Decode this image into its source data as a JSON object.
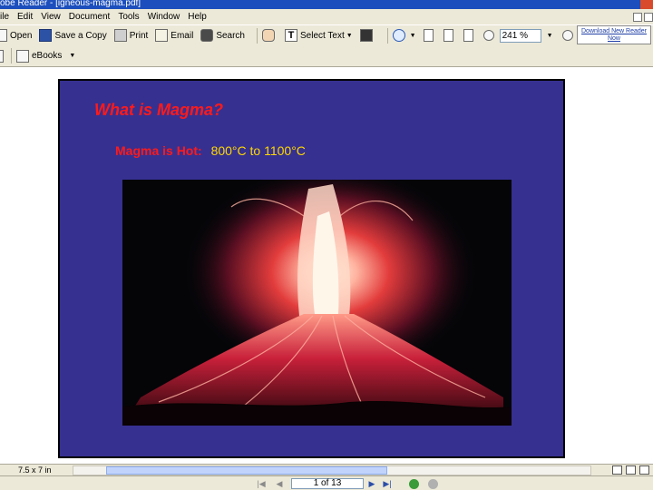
{
  "window": {
    "title": "obe Reader - [igneous-magma.pdf]"
  },
  "menu": {
    "items": [
      "ile",
      "Edit",
      "View",
      "Document",
      "Tools",
      "Window",
      "Help"
    ]
  },
  "toolbar": {
    "open": "Open",
    "save_copy": "Save a Copy",
    "print": "Print",
    "email": "Email",
    "search": "Search",
    "select_text": "Select Text",
    "zoom_value": "241 %",
    "ebooks": "eBooks",
    "banner": "Download New Reader Now"
  },
  "slide": {
    "title": "What is Magma?",
    "subtitle_label": "Magma is Hot:",
    "subtitle_value": "800°C to 1100°C",
    "background": "#363091",
    "title_color": "#ff1a1a",
    "value_color": "#ffd700"
  },
  "status": {
    "page_size": "7.5 x 7 in",
    "page_indicator": "1 of 13"
  },
  "icons": [
    "open-icon",
    "save-icon",
    "print-icon",
    "email-icon",
    "search-icon",
    "hand-icon",
    "select-text-icon",
    "snapshot-icon",
    "zoom-icon",
    "page-icon",
    "zoom-out-icon",
    "zoom-in-icon",
    "ebook-icon",
    "first-page-icon",
    "prev-page-icon",
    "next-page-icon",
    "last-page-icon",
    "back-icon",
    "forward-icon"
  ]
}
